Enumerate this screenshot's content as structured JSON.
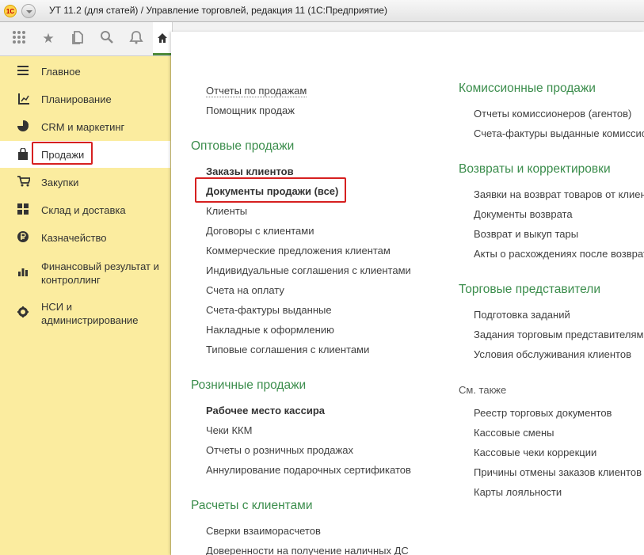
{
  "window": {
    "title": "УТ 11.2 (для статей) / Управление торговлей, редакция 11  (1С:Предприятие)",
    "logo_text": "1С"
  },
  "toolbar": {
    "icons": [
      "apps-grid-icon",
      "star-icon",
      "history-icon",
      "search-icon",
      "bell-icon",
      "home-icon"
    ]
  },
  "sidebar": {
    "items": [
      {
        "label": "Главное",
        "icon": "menu-lines-icon"
      },
      {
        "label": "Планирование",
        "icon": "planning-chart-icon"
      },
      {
        "label": "CRM и маркетинг",
        "icon": "pie-chart-icon"
      },
      {
        "label": "Продажи",
        "icon": "shopping-bag-icon",
        "active": true
      },
      {
        "label": "Закупки",
        "icon": "cart-icon"
      },
      {
        "label": "Склад и доставка",
        "icon": "warehouse-grid-icon"
      },
      {
        "label": "Казначейство",
        "icon": "ruble-icon"
      },
      {
        "label": "Финансовый результат и контроллинг",
        "icon": "bar-chart-icon"
      },
      {
        "label": "НСИ и администрирование",
        "icon": "gear-icon"
      }
    ]
  },
  "main": {
    "top_links": [
      "Отчеты по продажам",
      "Помощник продаж"
    ],
    "wholesale": {
      "title": "Оптовые продажи",
      "links": [
        "Заказы клиентов",
        "Документы продажи (все)",
        "Клиенты",
        "Договоры с клиентами",
        "Коммерческие предложения клиентам",
        "Индивидуальные соглашения с клиентами",
        "Счета на оплату",
        "Счета-фактуры выданные",
        "Накладные к оформлению",
        "Типовые соглашения с клиентами"
      ]
    },
    "retail": {
      "title": "Розничные продажи",
      "links": [
        "Рабочее место кассира",
        "Чеки ККМ",
        "Отчеты о розничных продажах",
        "Аннулирование подарочных сертификатов"
      ]
    },
    "settlements": {
      "title": "Расчеты с клиентами",
      "links": [
        "Сверки взаиморасчетов",
        "Доверенности на получение наличных ДС"
      ]
    },
    "commission": {
      "title": "Комиссионные продажи",
      "links": [
        "Отчеты комиссионеров (агентов)",
        "Счета-фактуры выданные комиссионерам"
      ]
    },
    "returns": {
      "title": "Возвраты и корректировки",
      "links": [
        "Заявки на возврат товаров от клиентов",
        "Документы возврата",
        "Возврат и выкуп тары",
        "Акты о расхождениях после возврата"
      ]
    },
    "reps": {
      "title": "Торговые представители",
      "links": [
        "Подготовка заданий",
        "Задания торговым представителям",
        "Условия обслуживания клиентов"
      ]
    },
    "see_also": {
      "title": "См. также",
      "links": [
        "Реестр торговых документов",
        "Кассовые смены",
        "Кассовые чеки коррекции",
        "Причины отмены заказов клиентов",
        "Карты лояльности"
      ]
    }
  },
  "colors": {
    "sidebar_bg": "#fbec9f",
    "section_title": "#3b8d4c",
    "highlight_border": "#d62020"
  }
}
